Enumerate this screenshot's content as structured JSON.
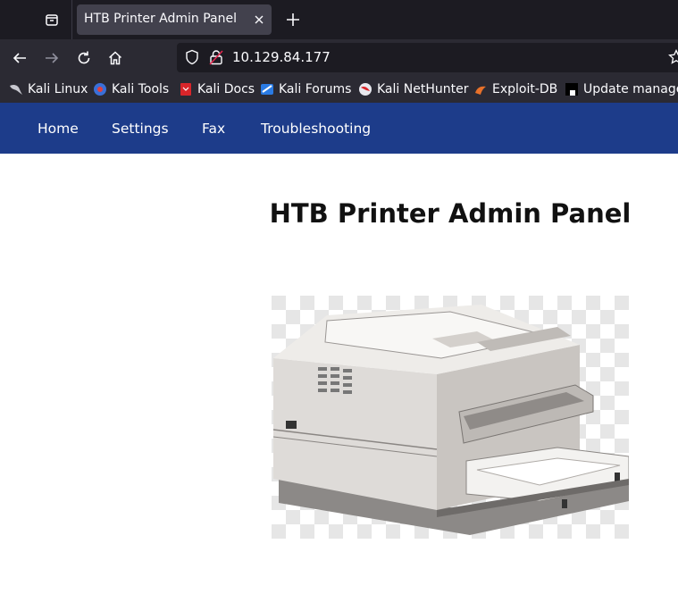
{
  "browser": {
    "tab_title": "HTB Printer Admin Panel",
    "url": "10.129.84.177",
    "bookmarks": [
      {
        "label": "Kali Linux",
        "icon": "kali-dragon-icon"
      },
      {
        "label": "Kali Tools",
        "icon": "kali-tools-icon"
      },
      {
        "label": "Kali Docs",
        "icon": "kali-docs-icon"
      },
      {
        "label": "Kali Forums",
        "icon": "kali-forums-icon"
      },
      {
        "label": "Kali NetHunter",
        "icon": "nethunter-icon"
      },
      {
        "label": "Exploit-DB",
        "icon": "exploit-db-icon"
      },
      {
        "label": "Update manager",
        "icon": "update-manager-icon"
      }
    ]
  },
  "site": {
    "nav": [
      "Home",
      "Settings",
      "Fax",
      "Troubleshooting"
    ],
    "heading": "HTB Printer Admin Panel",
    "nav_color": "#1d3c8a"
  }
}
